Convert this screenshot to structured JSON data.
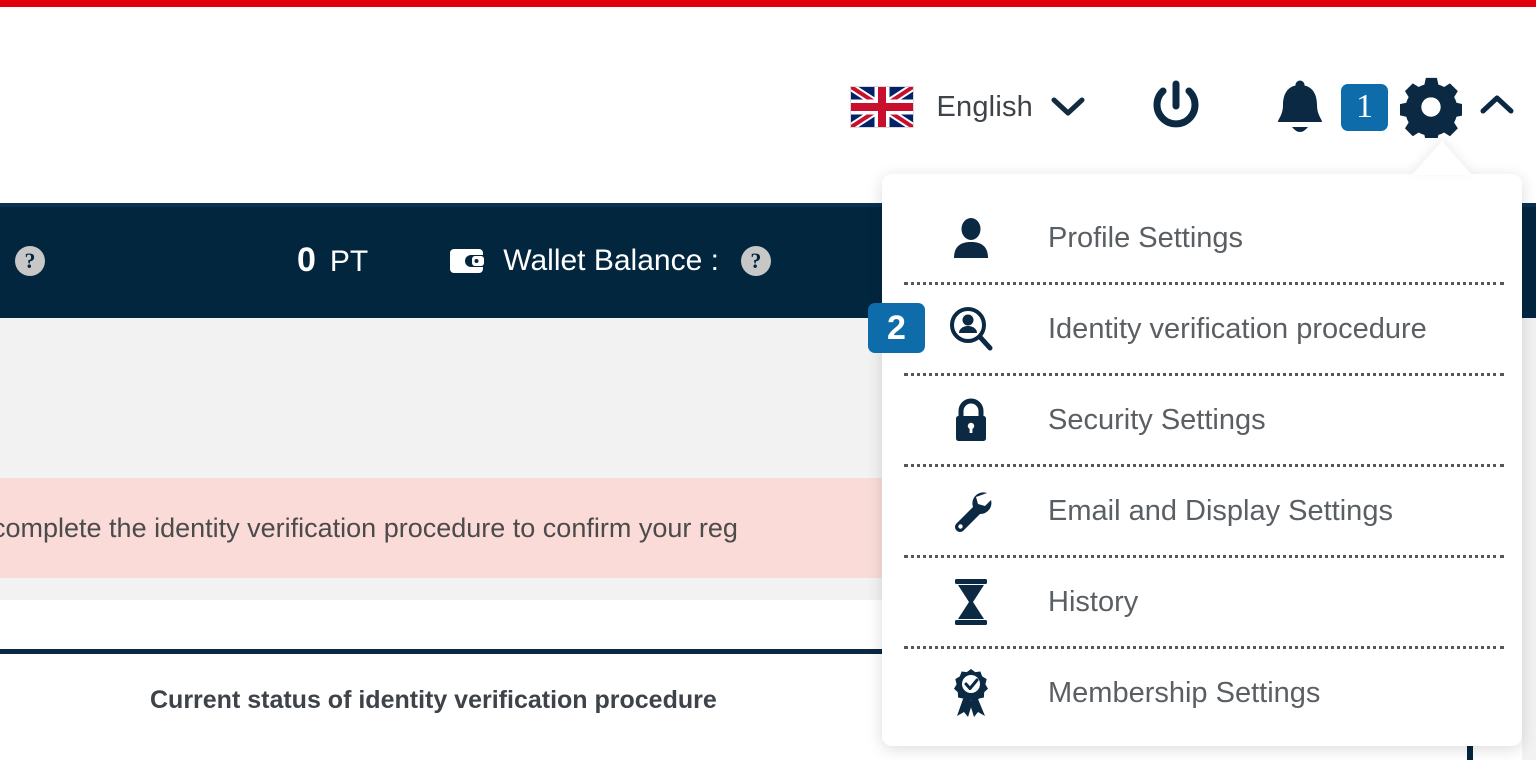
{
  "theme": {
    "accent_red": "#e2000f",
    "navy": "#03263f",
    "badge_blue": "#0e6cab",
    "alert_pink": "#fadbd8",
    "page_grey": "#f2f2f2"
  },
  "header": {
    "language": {
      "label": "English",
      "flag": "uk-flag",
      "chevron": "chevron-down-icon"
    },
    "power_icon": "power-icon",
    "bell_icon": "bell-icon",
    "badge_count": "1",
    "gear_icon": "gear-icon",
    "collapse_chevron": "chevron-up-icon"
  },
  "status_bar": {
    "help_icon_left": "help-icon",
    "points_value": "0",
    "points_unit": "PT",
    "wallet_icon": "wallet-icon",
    "wallet_label": "Wallet Balance :",
    "help_icon_wallet": "help-icon"
  },
  "alert": {
    "message": "complete the identity verification procedure to confirm your reg"
  },
  "panel": {
    "title": "Current status of identity verification procedure"
  },
  "dropdown": {
    "step_badge": "2",
    "items": [
      {
        "label": "Profile Settings",
        "icon": "user-icon"
      },
      {
        "label": "Identity verification procedure",
        "icon": "identity-search-icon"
      },
      {
        "label": "Security Settings",
        "icon": "lock-icon"
      },
      {
        "label": "Email and Display Settings",
        "icon": "wrench-icon"
      },
      {
        "label": "History",
        "icon": "hourglass-icon"
      },
      {
        "label": "Membership Settings",
        "icon": "award-icon"
      }
    ]
  }
}
